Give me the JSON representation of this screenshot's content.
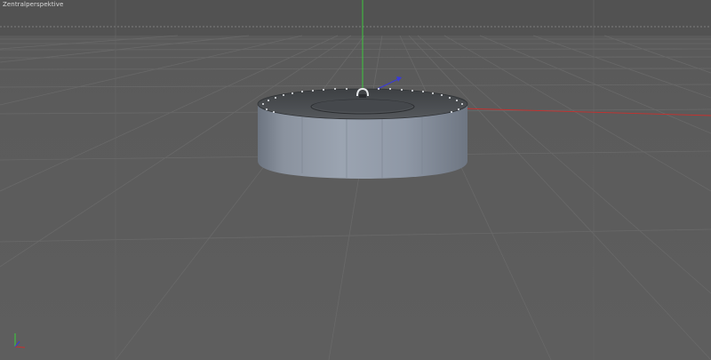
{
  "viewport": {
    "label": "Zentralperspektive"
  },
  "colors": {
    "background": "#5d5d5d",
    "grid": "#6a6a6a",
    "safe_frame": "#9a9a9a",
    "axis_x": "#c8302e",
    "axis_y": "#3bd23b",
    "axis_z": "#3a3ad8",
    "object_side": "#8a95a4",
    "object_top": "#4c4f53"
  },
  "scene": {
    "object": "cylinder-with-lid",
    "axes_icon": "world-axes-icon"
  }
}
